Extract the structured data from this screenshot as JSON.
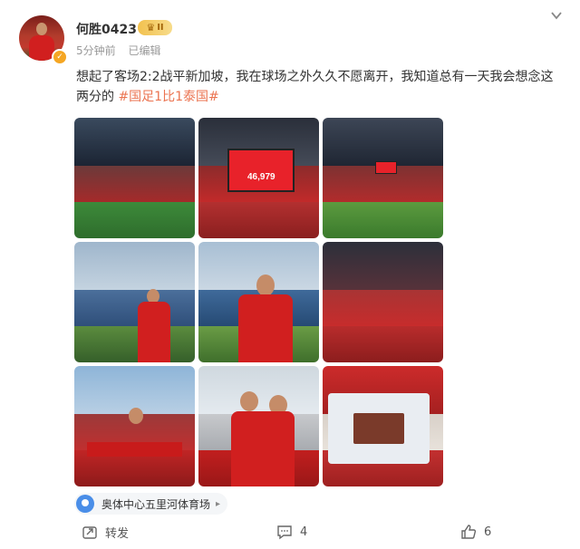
{
  "post": {
    "username": "何胜0423",
    "badge_level": "II",
    "time": "5分钟前",
    "edited": "已编辑",
    "text": "想起了客场2:2战平新加坡，我在球场之外久久不愿离开，我知道总有一天我会想念这两分的 ",
    "hashtag": "#国足1比1泰国#",
    "scoreboard_number": "46,979",
    "location": "奥体中心五里河体育场"
  },
  "actions": {
    "repost_label": "转发",
    "comment_count": "4",
    "like_count": "6"
  },
  "icons": [
    "chevron-down-icon",
    "verified-icon",
    "crown-icon",
    "location-icon",
    "repost-icon",
    "comment-icon",
    "like-icon"
  ],
  "colors": {
    "hashtag": "#eb7350",
    "accent_red": "#d11f1f",
    "location_blue": "#4a8ee8"
  }
}
